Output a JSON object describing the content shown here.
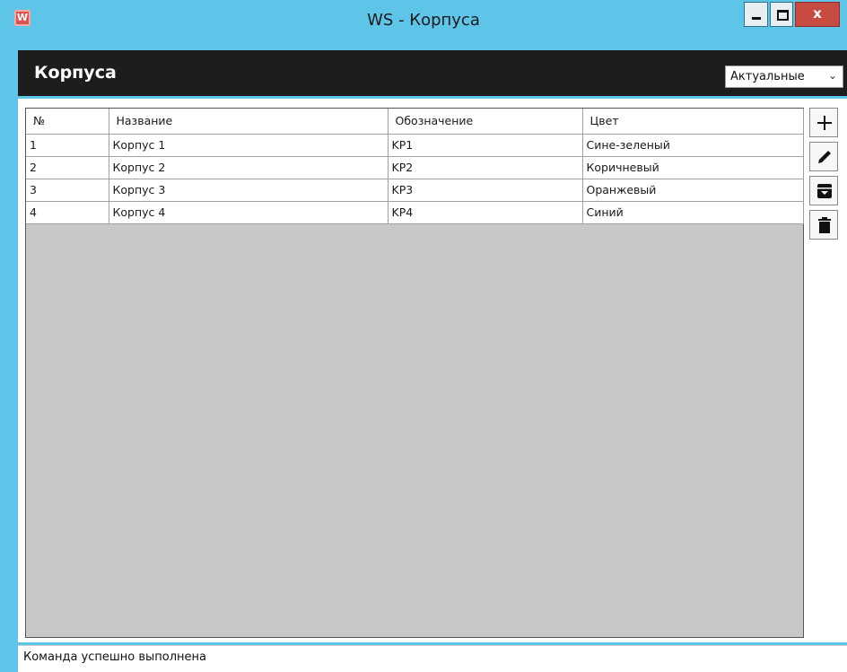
{
  "window": {
    "title": "WS - Корпуса",
    "app_icon": "ws-app-icon",
    "app_icon_glyph": "W",
    "close_glyph": "x"
  },
  "header": {
    "title": "Корпуса",
    "filter": {
      "selected": "Актуальные"
    }
  },
  "table": {
    "columns": [
      "№",
      "Название",
      "Обозначение",
      "Цвет"
    ],
    "rows": [
      [
        "1",
        "Корпус 1",
        "KP1",
        "Сине-зеленый"
      ],
      [
        "2",
        "Корпус 2",
        "KP2",
        "Коричневый"
      ],
      [
        "3",
        "Корпус 3",
        "KP3",
        "Оранжевый"
      ],
      [
        "4",
        "Корпус 4",
        "KP4",
        "Синий"
      ]
    ]
  },
  "toolbar": {
    "icons": [
      "plus-icon",
      "pencil-icon",
      "archive-icon",
      "trash-icon"
    ]
  },
  "status": {
    "text": "Команда успешно выполнена"
  },
  "colors": {
    "titlebar": "#5ec4e8",
    "header": "#1d1d1d",
    "grid_bg": "#c8c8c8",
    "close": "#c74b40"
  }
}
